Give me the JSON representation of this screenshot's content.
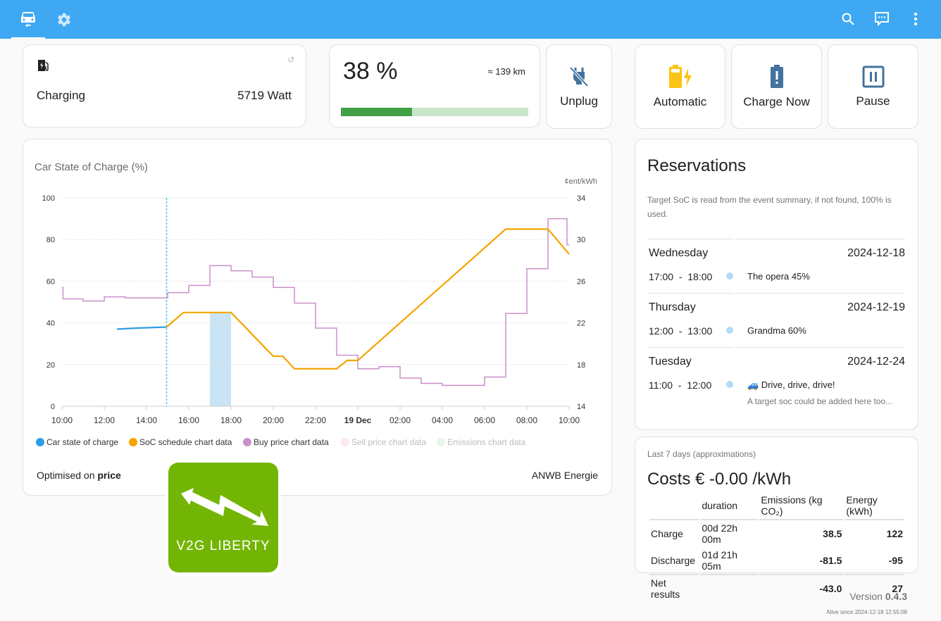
{
  "topbar": {
    "tabs": [
      {
        "name": "car-charging",
        "icon": "car-electric-icon",
        "active": true
      },
      {
        "name": "settings",
        "icon": "gear-icon",
        "active": false
      }
    ],
    "actions": [
      "search-icon",
      "chat-icon",
      "more-vertical-icon"
    ],
    "color": "#3ea8f2"
  },
  "charger": {
    "icon": "ev-station-icon",
    "status": "Charging",
    "power": "5719 Watt",
    "refresh_icon": "refresh-icon"
  },
  "soc": {
    "value": "38 %",
    "range": "≈ 139 km",
    "progress_percent": 38,
    "bar_color": "#43a047",
    "bar_bg": "#c8e6c9"
  },
  "buttons": {
    "unplug": "Unplug",
    "automatic": "Automatic",
    "charge_now": "Charge Now",
    "pause": "Pause"
  },
  "chart_card": {
    "title": "Car State of Charge (%)",
    "optimised_prefix": "Optimised on ",
    "optimised_value": "price",
    "provider": "ANWB Energie"
  },
  "chart_data": {
    "type": "line",
    "title": "Car State of Charge (%)",
    "xlabel": "",
    "ylabel": "%",
    "y2label": "¢ent/kWh",
    "x_range_hours": [
      0,
      24
    ],
    "x_ticks": [
      "10:00",
      "12:00",
      "14:00",
      "16:00",
      "18:00",
      "20:00",
      "22:00",
      "19 Dec",
      "02:00",
      "04:00",
      "06:00",
      "08:00",
      "10:00"
    ],
    "x_tick_bold_index": 7,
    "ylim": [
      0,
      100
    ],
    "y_ticks": [
      "0",
      "20",
      "40",
      "60",
      "80",
      "100"
    ],
    "y2lim": [
      14,
      34
    ],
    "y2_ticks": [
      "14",
      "18",
      "22",
      "26",
      "30",
      "34"
    ],
    "grid": true,
    "now_hour": 4.95,
    "reservation_band": {
      "from_hour": 7,
      "to_hour": 8
    },
    "legend_position": "bottom",
    "series": [
      {
        "name": "Car state of charge",
        "color": "#2d9ee5",
        "axis": "left",
        "points": [
          [
            2.6,
            37
          ],
          [
            3.5,
            37.5
          ],
          [
            4.95,
            38
          ]
        ]
      },
      {
        "name": "SoC schedule chart data",
        "color": "#f5a400",
        "axis": "left",
        "points": [
          [
            4.95,
            38
          ],
          [
            5.75,
            45
          ],
          [
            8.0,
            45
          ],
          [
            10.0,
            24
          ],
          [
            10.45,
            24
          ],
          [
            11.0,
            18
          ],
          [
            13.0,
            18
          ],
          [
            13.5,
            22
          ],
          [
            14.0,
            22
          ],
          [
            21.0,
            85
          ],
          [
            23.0,
            85
          ],
          [
            24.0,
            73
          ]
        ]
      },
      {
        "name": "Buy price chart data",
        "color": "#c990c9",
        "axis": "right",
        "step": true,
        "points": [
          [
            0,
            25.4
          ],
          [
            0.05,
            24.3
          ],
          [
            1,
            24.1
          ],
          [
            2,
            24.5
          ],
          [
            3,
            24.4
          ],
          [
            5,
            24.9
          ],
          [
            6,
            25.6
          ],
          [
            7,
            27.5
          ],
          [
            8,
            27.0
          ],
          [
            9,
            26.4
          ],
          [
            10,
            25.4
          ],
          [
            11,
            23.9
          ],
          [
            12,
            21.5
          ],
          [
            13,
            18.9
          ],
          [
            14,
            17.6
          ],
          [
            15,
            17.8
          ],
          [
            16,
            16.7
          ],
          [
            17,
            16.2
          ],
          [
            18,
            16.0
          ],
          [
            20,
            16.8
          ],
          [
            21,
            22.9
          ],
          [
            22,
            27.2
          ],
          [
            23,
            32.0
          ],
          [
            23.9,
            29.5
          ]
        ]
      },
      {
        "name": "Sell price chart data",
        "color": "#fde8ec",
        "axis": "right",
        "hidden": true,
        "points": []
      },
      {
        "name": "Emissions chart data",
        "color": "#e8f5e9",
        "axis": "right",
        "hidden": true,
        "points": []
      }
    ]
  },
  "logo": {
    "text": "V2G LIBERTY",
    "color": "#73b504"
  },
  "reservations": {
    "title": "Reservations",
    "note": "Target SoC is read from the event summary, if not found, 100% is used.",
    "days": [
      {
        "day": "Wednesday",
        "date": "2024-12-18",
        "time": "17:00  -  18:00",
        "summary": "The opera 45%",
        "description": ""
      },
      {
        "day": "Thursday",
        "date": "2024-12-19",
        "time": "12:00  -  13:00",
        "summary": "Grandma 60%",
        "description": ""
      },
      {
        "day": "Tuesday",
        "date": "2024-12-24",
        "time": "11:00  -  12:00",
        "summary": "🚙 Drive, drive, drive!",
        "description": "A target soc could be added here too..."
      }
    ]
  },
  "stats": {
    "subtitle": "Last 7 days (approximations)",
    "costs": "Costs € -0.00 /kWh",
    "headers": [
      "",
      "duration",
      "Emissions (kg CO₂)",
      "Energy (kWh)"
    ],
    "rows": [
      [
        "Charge",
        "00d 22h 00m",
        "38.5",
        "122"
      ],
      [
        "Discharge",
        "01d 21h 05m",
        "-81.5",
        "-95"
      ],
      [
        "Net results",
        "",
        "-43.0",
        "27"
      ]
    ]
  },
  "footer": {
    "version_label": "Version ",
    "version": "0.4.3",
    "alive": "Alive since 2024-12-18 12:55:08"
  }
}
